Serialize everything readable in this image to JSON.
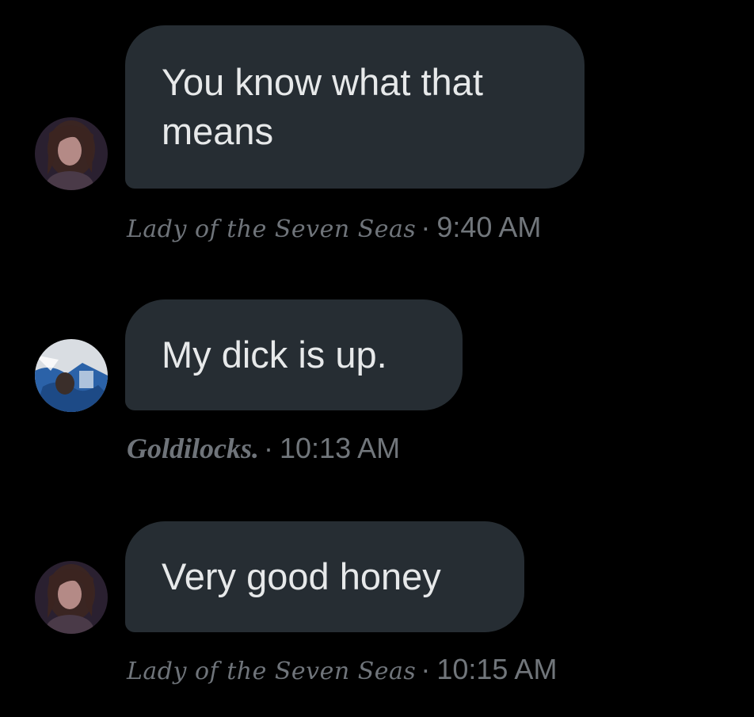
{
  "messages": [
    {
      "text": "You know what that\nmeans",
      "author": "Lady of the Seven Seas",
      "separator": "·",
      "time": "9:40 AM",
      "avatar": "woman-portrait-avatar"
    },
    {
      "text": "My dick is up.",
      "author": "Goldilocks.",
      "separator": "·",
      "time": "10:13 AM",
      "avatar": "blue-photo-avatar"
    },
    {
      "text": "Very good honey",
      "author": "Lady of the Seven Seas",
      "separator": "·",
      "time": "10:15 AM",
      "avatar": "woman-portrait-avatar"
    }
  ],
  "colors": {
    "background": "#000000",
    "bubble": "#262d33",
    "bubble_text": "#e7e9ea",
    "meta_text": "#71767b"
  }
}
